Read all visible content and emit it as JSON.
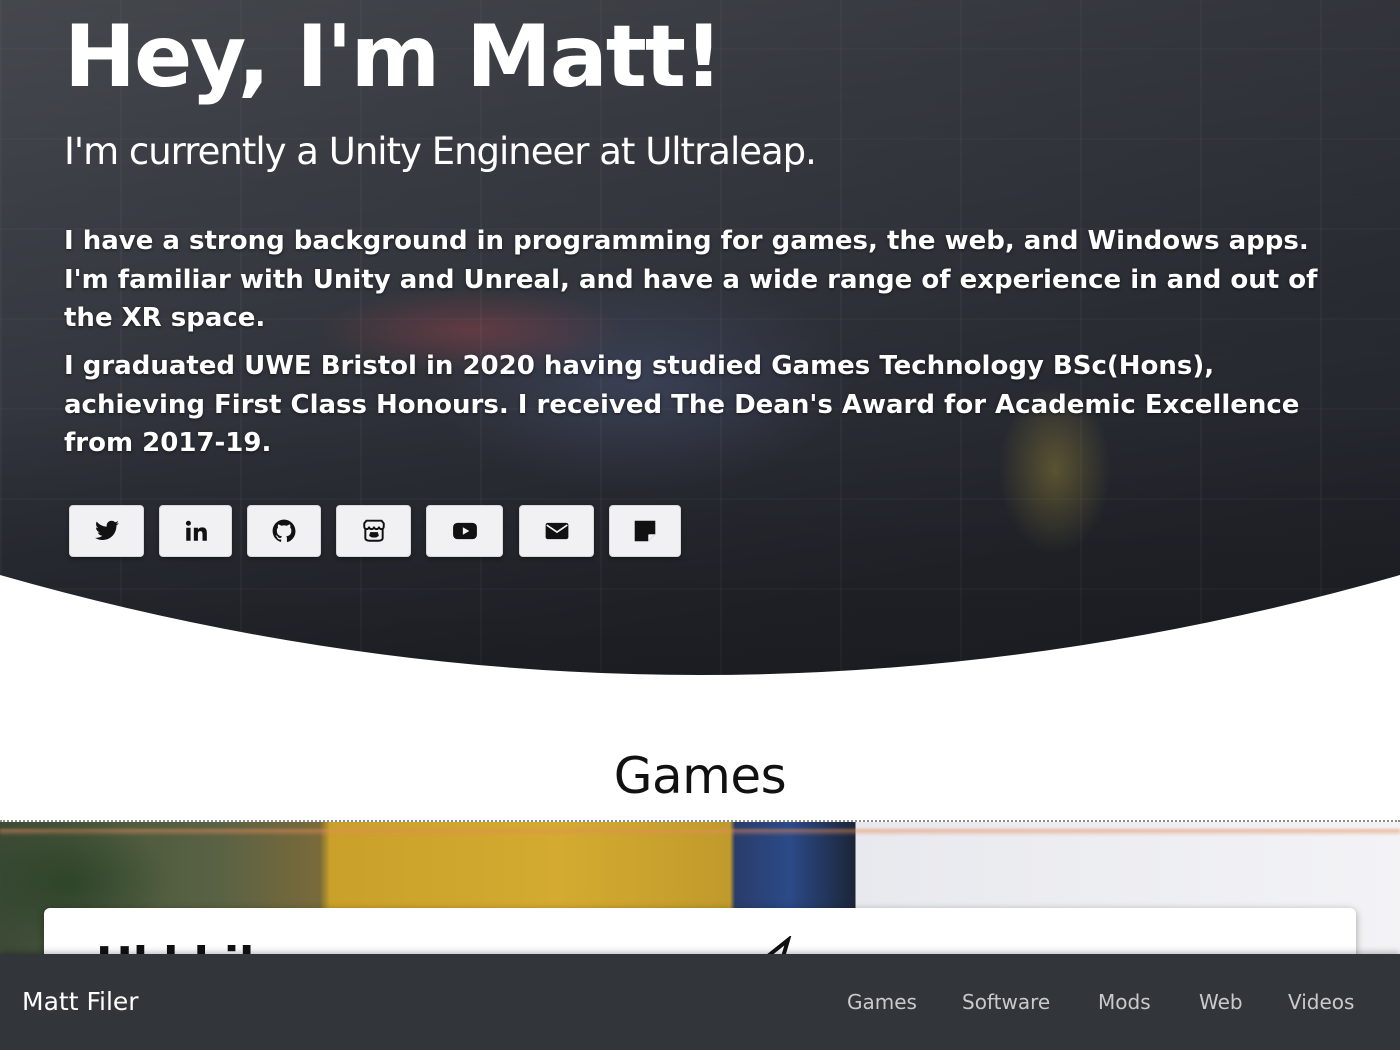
{
  "hero": {
    "title": "Hey, I'm Matt!",
    "subtitle": "I'm currently a Unity Engineer at Ultraleap.",
    "paragraphs": [
      "I have a strong background in programming for games, the web, and Windows apps. I'm familiar with Unity and Unreal, and have a wide range of experience in and out of the XR space.",
      "I graduated UWE Bristol in 2020 having studied Games Technology BSc(Hons), achieving First Class Honours. I received The Dean's Award for Academic Excellence from 2017-19."
    ],
    "social_icons": [
      "twitter-icon",
      "linkedin-icon",
      "github-icon",
      "itchio-icon",
      "youtube-icon",
      "email-icon",
      "blog-icon"
    ]
  },
  "games": {
    "section_title": "Games",
    "card_title": "Hl      l         l                   il"
  },
  "navbar": {
    "brand": "Matt Filer",
    "links": [
      "Games",
      "Software",
      "Mods",
      "Web",
      "Videos"
    ]
  },
  "colors": {
    "navbar_bg": "#323539",
    "nav_link": "#c9cacc",
    "button_bg": "#f1f1f3",
    "text_dark": "#111111"
  }
}
